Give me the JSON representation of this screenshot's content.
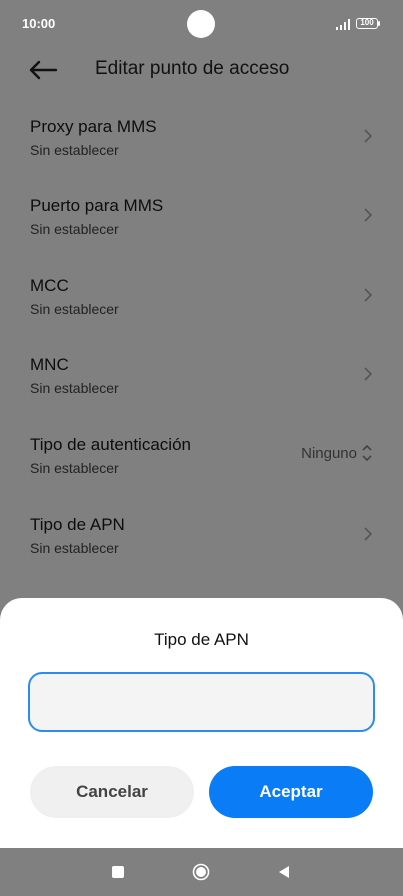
{
  "status_bar": {
    "time": "10:00",
    "battery": "100"
  },
  "header": {
    "title": "Editar punto de acceso"
  },
  "list": {
    "items": [
      {
        "title": "Proxy para MMS",
        "subtitle": "Sin establecer"
      },
      {
        "title": "Puerto para MMS",
        "subtitle": "Sin establecer"
      },
      {
        "title": "MCC",
        "subtitle": "Sin establecer"
      },
      {
        "title": "MNC",
        "subtitle": "Sin establecer"
      },
      {
        "title": "Tipo de autenticación",
        "subtitle": "Sin establecer",
        "value": "Ninguno"
      },
      {
        "title": "Tipo de APN",
        "subtitle": "Sin establecer"
      }
    ]
  },
  "dialog": {
    "title": "Tipo de APN",
    "input_value": "",
    "input_placeholder": "",
    "cancel_label": "Cancelar",
    "ok_label": "Aceptar"
  },
  "colors": {
    "accent": "#0a7cf5",
    "overlay": "#808080",
    "sheet": "#ffffff"
  }
}
